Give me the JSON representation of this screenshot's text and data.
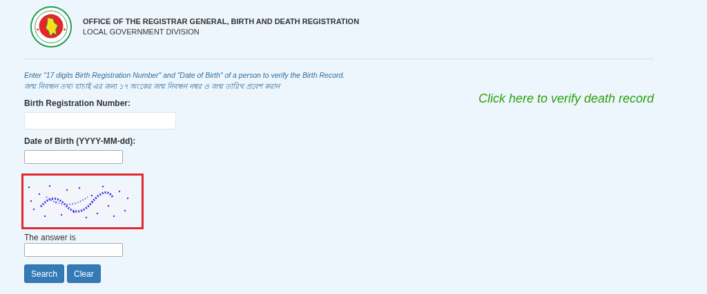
{
  "header": {
    "title": "OFFICE OF THE REGISTRAR GENERAL, BIRTH AND DEATH REGISTRATION",
    "subtitle": "LOCAL GOVERNMENT DIVISION"
  },
  "instructions": [
    "Enter \"17 digits Birth Registration Number\" and \"Date of Birth\" of a person to verify the Birth Record.",
    "জন্ম নিবন্ধন তথ্য যাচাই এর জন্য ১৭ অংকের জন্ম নিবন্ধন নম্বর ও জন্ম তারিখ প্রবেশ করান"
  ],
  "fields": [
    {
      "label": "Birth Registration Number:",
      "kind": "wide"
    },
    {
      "label": "Date of Birth (YYYY-MM-dd):",
      "kind": "narrow"
    }
  ],
  "captcha": {
    "kind": "picture",
    "highlighted": true
  },
  "answer": {
    "label": "The answer is"
  },
  "buttons": [
    "Search",
    "Clear"
  ],
  "death_link": "Click here to verify death record"
}
